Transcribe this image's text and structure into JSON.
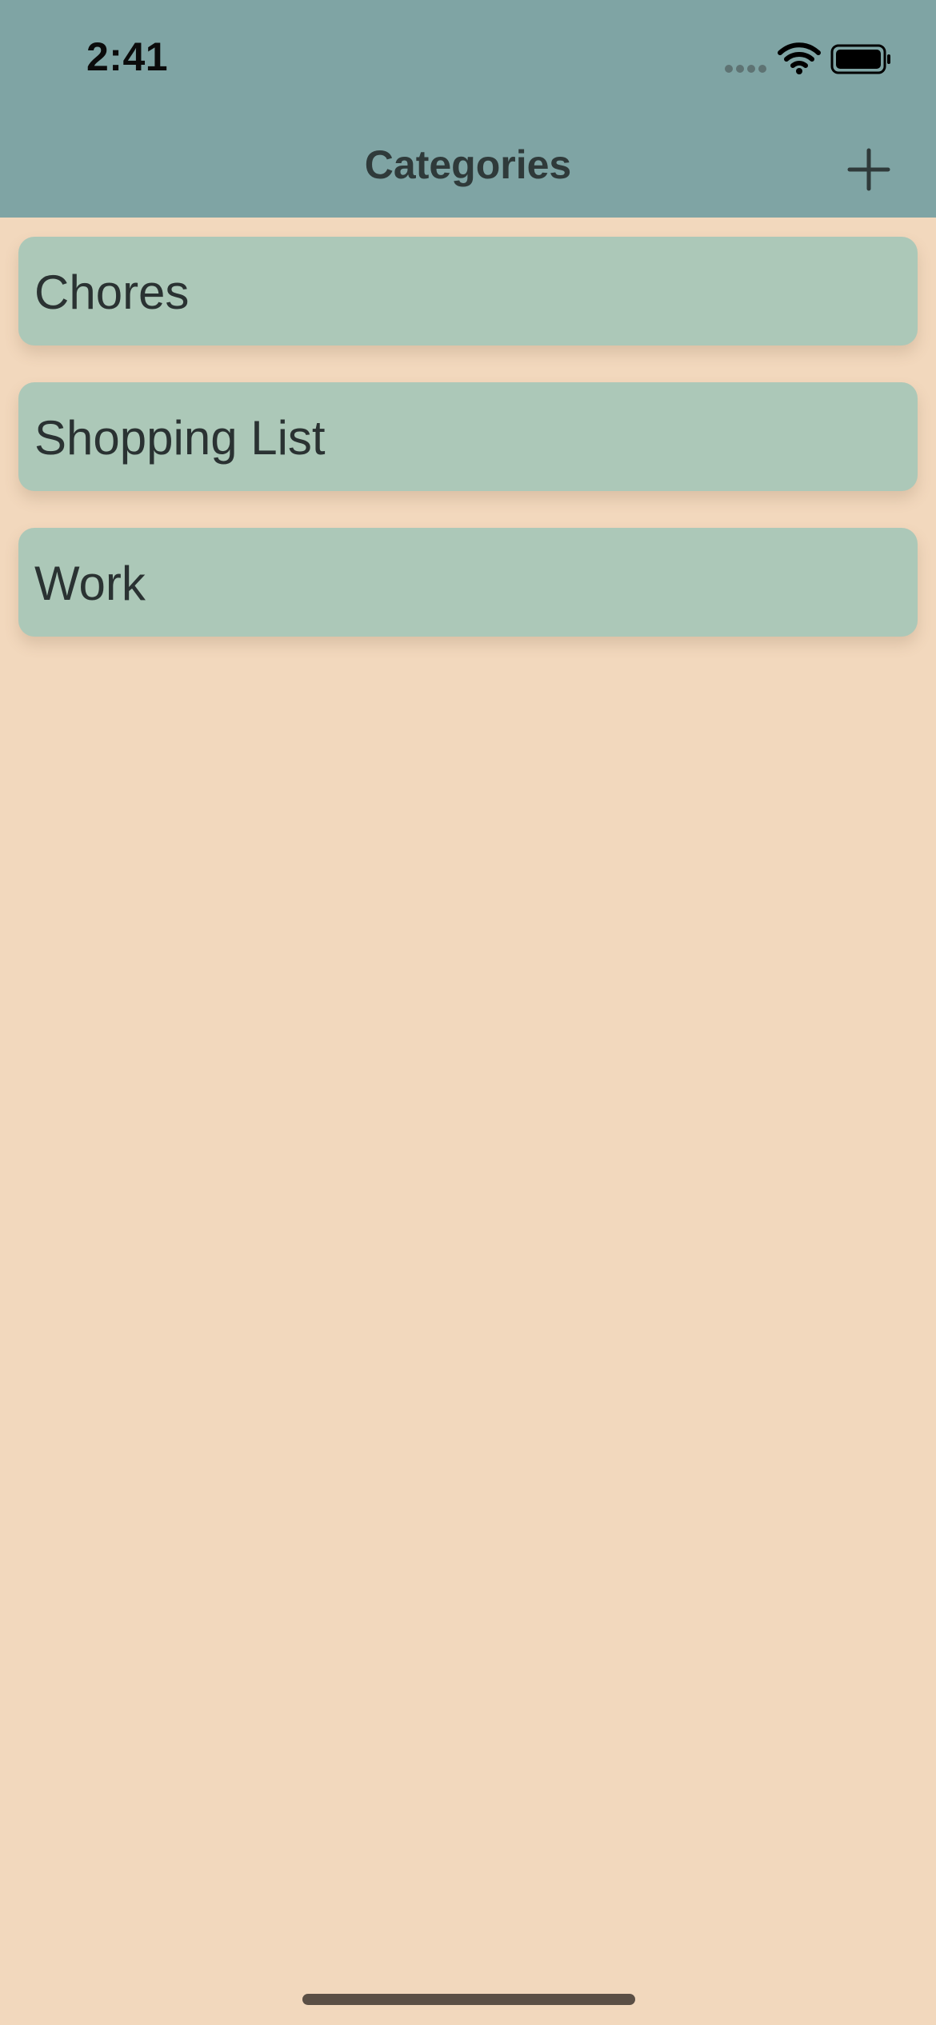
{
  "status_bar": {
    "time": "2:41",
    "icons": [
      "signal-dots-icon",
      "wifi-icon",
      "battery-icon"
    ]
  },
  "nav_bar": {
    "title": "Categories",
    "add_icon": "plus-icon"
  },
  "categories": [
    {
      "label": "Chores"
    },
    {
      "label": "Shopping List"
    },
    {
      "label": "Work"
    }
  ],
  "colors": {
    "nav_background": "#7fa4a4",
    "page_background": "#f2d8bd",
    "card_background": "#acc8b8",
    "text": "#2b3433"
  }
}
